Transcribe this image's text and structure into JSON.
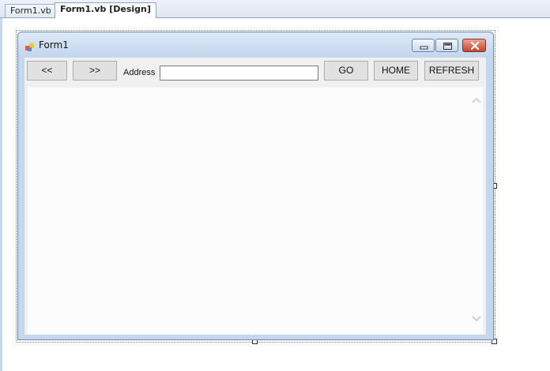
{
  "tabs": [
    {
      "label": "Form1.vb",
      "active": false
    },
    {
      "label": "Form1.vb [Design]",
      "active": true
    }
  ],
  "form": {
    "title": "Form1",
    "icons": {
      "app": "form-app-icon",
      "minimize": "minimize-icon",
      "maximize": "maximize-icon",
      "close": "close-icon"
    }
  },
  "toolbar": {
    "back_label": "<<",
    "forward_label": ">>",
    "address_label": "Address",
    "address_value": "",
    "go_label": "GO",
    "home_label": "HOME",
    "refresh_label": "REFRESH"
  },
  "colors": {
    "titlebar": "#c4d7ee",
    "close_button": "#c5432c",
    "client": "#f0f0f0"
  }
}
